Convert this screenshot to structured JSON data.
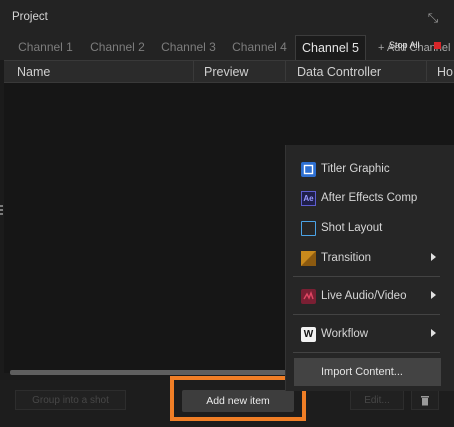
{
  "panel": {
    "title": "Project"
  },
  "tabs": [
    {
      "label": "Channel 1"
    },
    {
      "label": "Channel 2"
    },
    {
      "label": "Channel 3"
    },
    {
      "label": "Channel 4"
    },
    {
      "label": "Channel 5",
      "active": true
    }
  ],
  "toolbar": {
    "add_channel_label": "+ Add Channel",
    "stop_all_label": "Stop All"
  },
  "columns": [
    "Name",
    "Preview",
    "Data Controller",
    "Ho"
  ],
  "bottom": {
    "group_into_shot_label": "Group into a shot",
    "add_new_item_label": "Add new item",
    "edit_label": "Edit..."
  },
  "menu": {
    "items": [
      {
        "label": "Titler Graphic",
        "icon": "titler-graphic-icon"
      },
      {
        "label": "After Effects Comp",
        "icon": "after-effects-icon",
        "icon_text": "Ae"
      },
      {
        "label": "Shot Layout",
        "icon": "shot-layout-icon"
      },
      {
        "label": "Transition",
        "icon": "transition-icon",
        "submenu": true
      },
      {
        "label": "Live Audio/Video",
        "icon": "live-audio-video-icon",
        "submenu": true
      },
      {
        "label": "Workflow",
        "icon": "workflow-icon",
        "icon_text": "W",
        "submenu": true
      }
    ],
    "import_label": "Import Content..."
  },
  "colors": {
    "accent_highlight": "#f07e26",
    "stop_indicator": "#d8262a",
    "after_effects": "#9999ff",
    "titler": "#2d6fd1",
    "transition": "#c8891c",
    "live_av": "#c2304a"
  }
}
